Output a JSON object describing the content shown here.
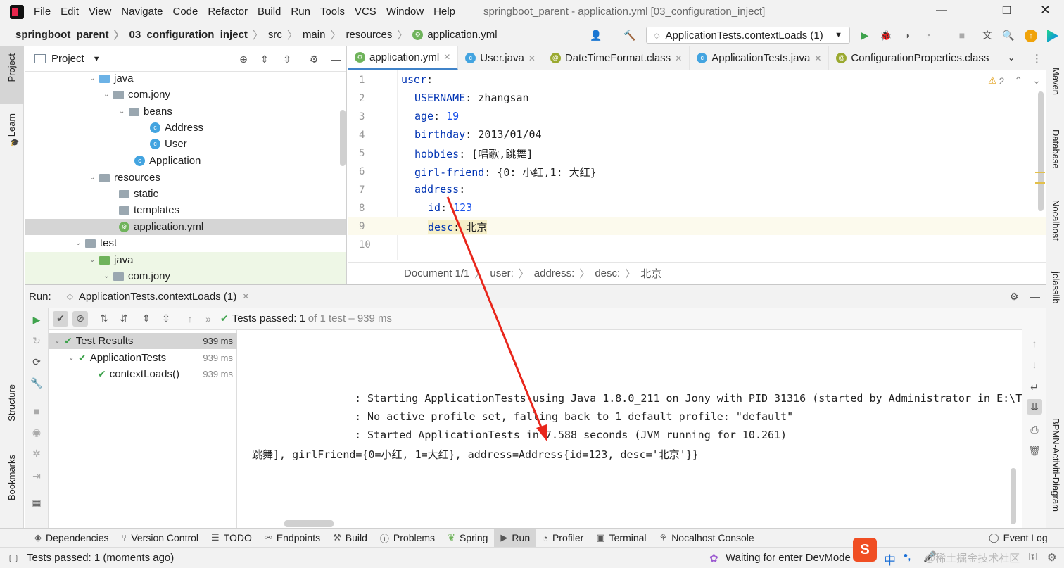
{
  "menu": [
    "File",
    "Edit",
    "View",
    "Navigate",
    "Code",
    "Refactor",
    "Build",
    "Run",
    "Tools",
    "VCS",
    "Window",
    "Help"
  ],
  "window_title": "springboot_parent - application.yml [03_configuration_inject]",
  "breadcrumbs": [
    "springboot_parent",
    "03_configuration_inject",
    "src",
    "main",
    "resources",
    "application.yml"
  ],
  "run_config": "ApplicationTests.contextLoads (1)",
  "left_strip": {
    "project": "Project",
    "learn": "Learn",
    "structure": "Structure",
    "bookmarks": "Bookmarks"
  },
  "right_strip": {
    "maven": "Maven",
    "database": "Database",
    "nocalhost": "Nocalhost",
    "jclasslib": "jclasslib",
    "bpmn": "BPMN-Activiti-Diagram"
  },
  "project_panel": {
    "title": "Project",
    "tree": [
      "java",
      "com.jony",
      "beans",
      "Address",
      "User",
      "Application",
      "resources",
      "static",
      "templates",
      "application.yml",
      "test",
      "java",
      "com.jony"
    ]
  },
  "editor": {
    "tabs": [
      "application.yml",
      "User.java",
      "DateTimeFormat.class",
      "ApplicationTests.java",
      "ConfigurationProperties.class"
    ],
    "warning_count": "2",
    "line_numbers": [
      "1",
      "2",
      "3",
      "4",
      "5",
      "6",
      "7",
      "8",
      "9",
      "10"
    ],
    "lines": [
      {
        "key": "user",
        "sep": ":",
        "value": ""
      },
      {
        "key": "USERNAME",
        "sep": ": ",
        "value": "zhangsan"
      },
      {
        "key": "age",
        "sep": ": ",
        "value": "19"
      },
      {
        "key": "birthday",
        "sep": ": ",
        "value": "2013/01/04"
      },
      {
        "key": "hobbies",
        "sep": ": ",
        "value": "[唱歌,跳舞]"
      },
      {
        "key": "girl-friend",
        "sep": ": ",
        "value": "{0: 小红,1: 大红}"
      },
      {
        "key": "address",
        "sep": ":",
        "value": ""
      },
      {
        "key": "id",
        "sep": ": ",
        "value": "123"
      },
      {
        "key": "desc",
        "sep": ": ",
        "value": "北京"
      }
    ],
    "crumbs": [
      "Document 1/1",
      "user:",
      "address:",
      "desc:",
      "北京"
    ]
  },
  "run": {
    "label": "Run:",
    "tab": "ApplicationTests.contextLoads (1)",
    "status_prefix": "Tests passed:",
    "status_count": "1",
    "status_suffix": "of 1 test – 939 ms",
    "tests": [
      {
        "name": "Test Results",
        "ms": "939 ms"
      },
      {
        "name": "ApplicationTests",
        "ms": "939 ms"
      },
      {
        "name": "contextLoads()",
        "ms": "939 ms"
      }
    ],
    "console": [
      ": Starting ApplicationTests using Java 1.8.0_211 on Jony with PID 31316 (started by Administrator in E:\\T",
      ": No active profile set, falling back to 1 default profile: \"default\"",
      ": Started ApplicationTests in 7.588 seconds (JVM running for 10.261)",
      "跳舞], girlFriend={0=小红, 1=大红}, address=Address{id=123, desc='北京'}}"
    ]
  },
  "bottom_tabs": [
    "Dependencies",
    "Version Control",
    "TODO",
    "Endpoints",
    "Build",
    "Problems",
    "Spring",
    "Run",
    "Profiler",
    "Terminal",
    "Nocalhost Console",
    "Event Log"
  ],
  "status": {
    "left": "Tests passed: 1 (moments ago)",
    "right": "Waiting for enter DevMode",
    "ime": "中",
    "watermark": "@稀土掘金技术社区"
  },
  "colors": {
    "accent": "#4083c9",
    "pass": "#3fa34d",
    "keyword": "#0033b3",
    "number": "#1750eb",
    "arrow": "#e8261b"
  }
}
